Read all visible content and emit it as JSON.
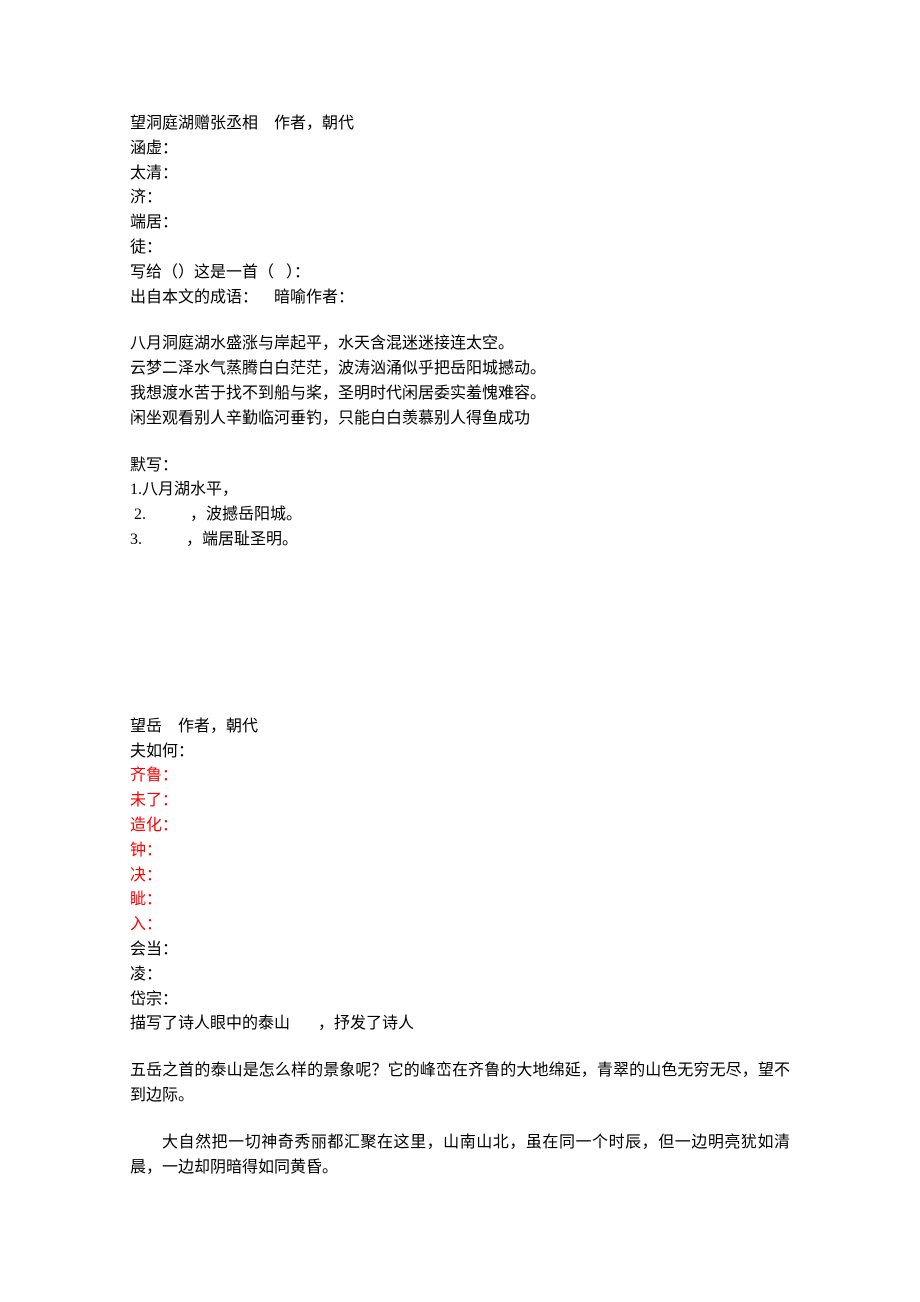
{
  "poem1": {
    "title_line": "望洞庭湖赠张丞相    作者，朝代",
    "terms": [
      "涵虚：",
      "太清：",
      "济：",
      "端居：",
      "徒："
    ],
    "q1": "写给（）这是一首（   ）：",
    "q2": "出自本文的成语：    暗喻作者：",
    "translation": [
      "八月洞庭湖水盛涨与岸起平，水天含混迷迷接连太空。",
      "云梦二泽水气蒸腾白白茫茫，波涛汹涌似乎把岳阳城撼动。",
      "我想渡水苦于找不到船与桨，圣明时代闲居委实羞愧难容。",
      "闲坐观看别人辛勤临河垂钓，只能白白羡慕别人得鱼成功"
    ],
    "moxie_label": "默写：",
    "moxie": [
      "1.八月湖水平，",
      " 2.           ，波撼岳阳城。",
      "3.           ，端居耻圣明。"
    ]
  },
  "poem2": {
    "title_line": "望岳    作者，朝代",
    "terms_plain": "夫如何：",
    "terms_red": [
      "齐鲁：",
      "未了：",
      "造化：",
      "钟：",
      "决：",
      "眦：",
      "入："
    ],
    "terms_plain2": [
      "会当：",
      "凌：",
      "岱宗："
    ],
    "q": "描写了诗人眼中的泰山       ，抒发了诗人",
    "translation1": "五岳之首的泰山是怎么样的景象呢？它的峰峦在齐鲁的大地绵延，青翠的山色无穷无尽，望不到边际。",
    "translation2": "大自然把一切神奇秀丽都汇聚在这里，山南山北，虽在同一个时辰，但一边明亮犹如清晨，一边却阴暗得如同黄昏。"
  }
}
